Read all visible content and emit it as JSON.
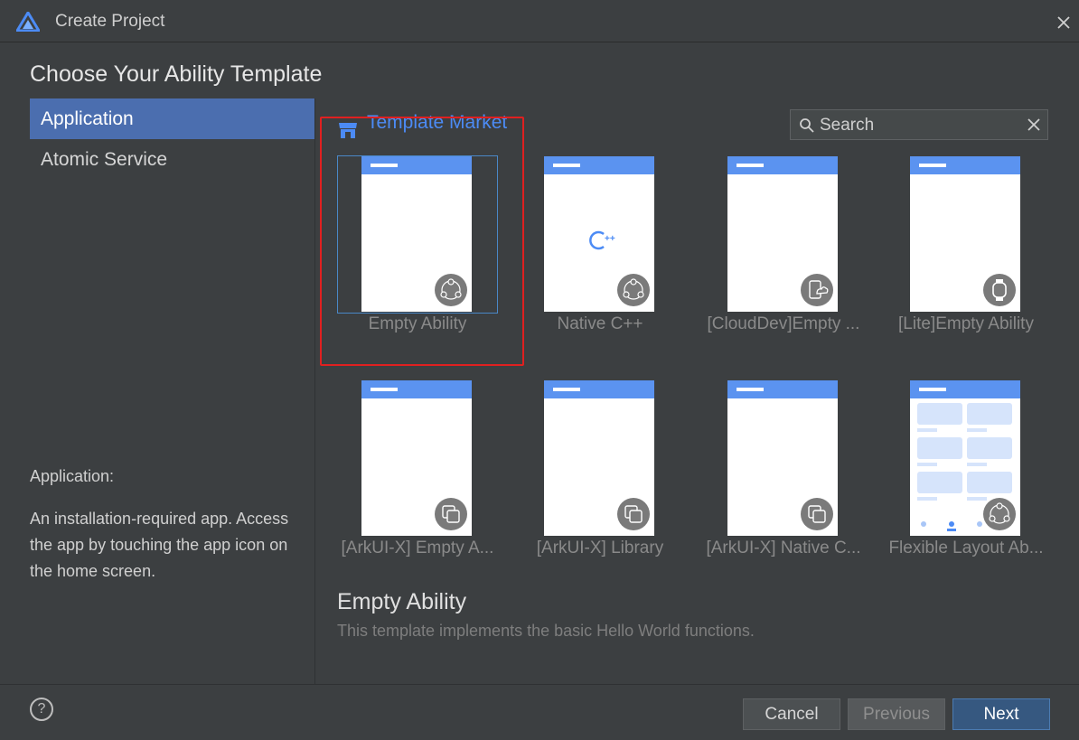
{
  "window": {
    "title": "Create Project"
  },
  "heading": "Choose Your Ability Template",
  "sidebar": {
    "items": [
      {
        "label": "Application",
        "selected": true
      },
      {
        "label": "Atomic Service",
        "selected": false
      }
    ]
  },
  "description": {
    "title": "Application:",
    "body": "An installation-required app. Access the app by touching the app icon on the home screen."
  },
  "market": {
    "label": "Template Market",
    "icon": "store-icon"
  },
  "search": {
    "placeholder": "Search",
    "value": ""
  },
  "templates": [
    {
      "label": "Empty Ability",
      "badge_icon": "share-nodes-icon",
      "selected": true
    },
    {
      "label": "Native C++",
      "badge_icon": "share-nodes-icon",
      "center_mark": "C++"
    },
    {
      "label": "[CloudDev]Empty ...",
      "badge_icon": "cloud-device-icon"
    },
    {
      "label": "[Lite]Empty Ability",
      "badge_icon": "watch-icon"
    },
    {
      "label": "[ArkUI-X] Empty A...",
      "badge_icon": "multi-device-icon"
    },
    {
      "label": "[ArkUI-X] Library",
      "badge_icon": "multi-device-icon"
    },
    {
      "label": "[ArkUI-X] Native C...",
      "badge_icon": "multi-device-icon"
    },
    {
      "label": "Flexible Layout Ab...",
      "badge_icon": "share-nodes-icon"
    }
  ],
  "detail": {
    "title": "Empty Ability",
    "description": "This template implements the basic Hello World functions."
  },
  "buttons": {
    "help": "?",
    "cancel": "Cancel",
    "previous": "Previous",
    "next": "Next"
  },
  "colors": {
    "accent": "#4b6eaf",
    "template_bar": "#5b93f0",
    "highlight": "#e02020",
    "market_text": "#4c8bf5"
  }
}
